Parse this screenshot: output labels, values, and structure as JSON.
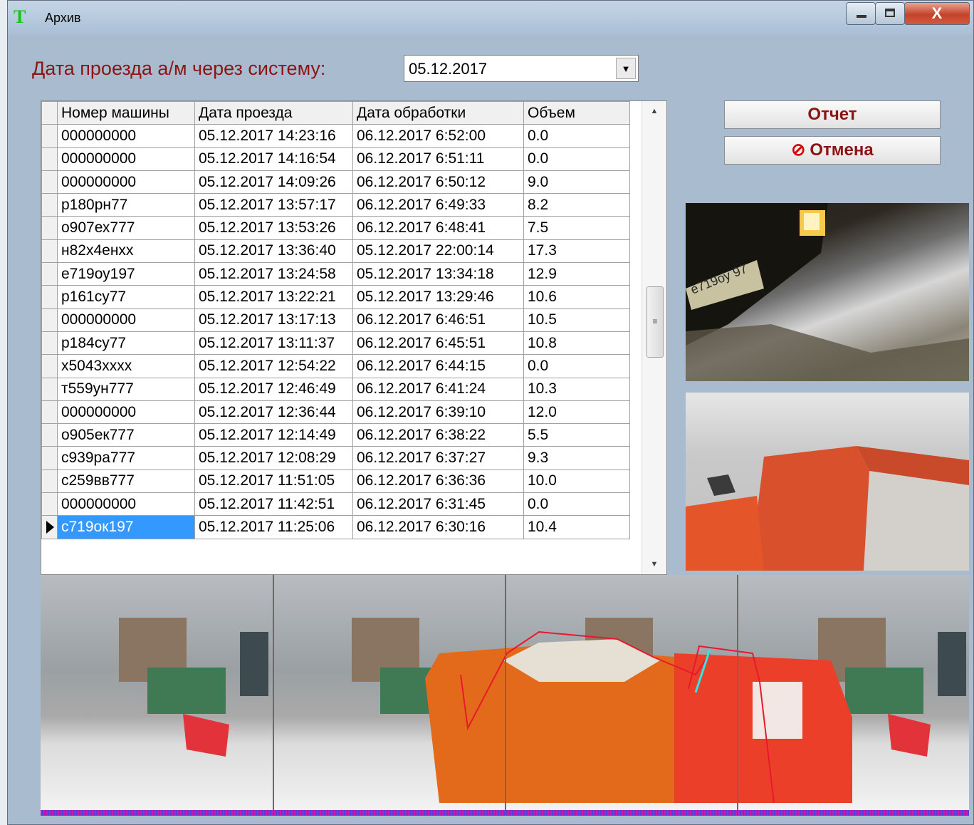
{
  "window": {
    "title": "Архив",
    "close_glyph": "X"
  },
  "filter": {
    "label": "Дата проезда а/м через систему:",
    "date_value": "05.12.2017"
  },
  "table": {
    "columns": [
      "Номер машины",
      "Дата проезда",
      "Дата обработки",
      "Объем"
    ],
    "rows": [
      [
        "000000000",
        "05.12.2017 14:23:16",
        "06.12.2017 6:52:00",
        "0.0"
      ],
      [
        "000000000",
        "05.12.2017 14:16:54",
        "06.12.2017 6:51:11",
        "0.0"
      ],
      [
        "000000000",
        "05.12.2017 14:09:26",
        "06.12.2017 6:50:12",
        "9.0"
      ],
      [
        "р180рн77",
        "05.12.2017 13:57:17",
        "06.12.2017 6:49:33",
        "8.2"
      ],
      [
        "о907ех777",
        "05.12.2017 13:53:26",
        "06.12.2017 6:48:41",
        "7.5"
      ],
      [
        "н82х4енхх",
        "05.12.2017 13:36:40",
        "05.12.2017 22:00:14",
        "17.3"
      ],
      [
        "е719оу197",
        "05.12.2017 13:24:58",
        "05.12.2017 13:34:18",
        "12.9"
      ],
      [
        "р161су77",
        "05.12.2017 13:22:21",
        "05.12.2017 13:29:46",
        "10.6"
      ],
      [
        "000000000",
        "05.12.2017 13:17:13",
        "06.12.2017 6:46:51",
        "10.5"
      ],
      [
        "р184су77",
        "05.12.2017 13:11:37",
        "06.12.2017 6:45:51",
        "10.8"
      ],
      [
        "х5043хххх",
        "05.12.2017 12:54:22",
        "06.12.2017 6:44:15",
        "0.0"
      ],
      [
        "т559ун777",
        "05.12.2017 12:46:49",
        "06.12.2017 6:41:24",
        "10.3"
      ],
      [
        "000000000",
        "05.12.2017 12:36:44",
        "06.12.2017 6:39:10",
        "12.0"
      ],
      [
        "о905ек777",
        "05.12.2017 12:14:49",
        "06.12.2017 6:38:22",
        "5.5"
      ],
      [
        "с939ра777",
        "05.12.2017 12:08:29",
        "06.12.2017 6:37:27",
        "9.3"
      ],
      [
        "с259вв777",
        "05.12.2017 11:51:05",
        "06.12.2017 6:36:36",
        "10.0"
      ],
      [
        "000000000",
        "05.12.2017 11:42:51",
        "06.12.2017 6:31:45",
        "0.0"
      ],
      [
        "с719ок197",
        "05.12.2017 11:25:06",
        "06.12.2017 6:30:16",
        "10.4"
      ]
    ],
    "selected_row": 17
  },
  "buttons": {
    "report": "Отчет",
    "cancel": "Отмена"
  },
  "images": {
    "plate_text": "е719оу 97"
  },
  "colors": {
    "accent_red": "#8d1414",
    "selection": "#3399ff",
    "truck_orange": "#e0641e",
    "overlay_red": "#e8192c",
    "overlay_cyan": "#2ee6e6"
  }
}
